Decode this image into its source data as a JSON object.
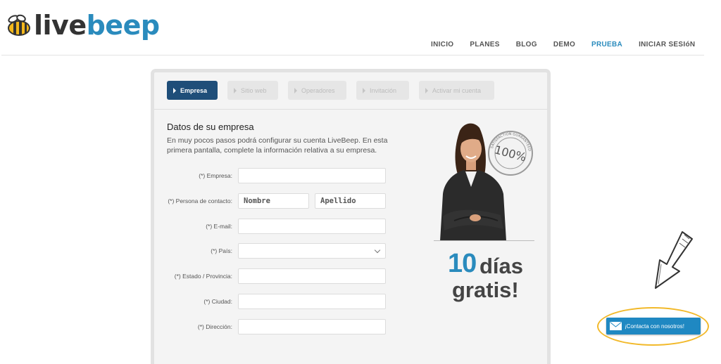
{
  "brand": {
    "live": "live",
    "beep": "beep"
  },
  "nav": {
    "items": [
      {
        "label": "INICIO",
        "active": false
      },
      {
        "label": "PLANES",
        "active": false
      },
      {
        "label": "BLOG",
        "active": false
      },
      {
        "label": "DEMO",
        "active": false
      },
      {
        "label": "PRUEBA",
        "active": true
      },
      {
        "label": "INICIAR SESIóN",
        "active": false
      }
    ]
  },
  "steps": [
    {
      "label": "Empresa",
      "active": true
    },
    {
      "label": "Sitio web",
      "active": false
    },
    {
      "label": "Operadores",
      "active": false
    },
    {
      "label": "Invitación",
      "active": false
    },
    {
      "label": "Activar mi cuenta",
      "active": false
    }
  ],
  "form": {
    "title": "Datos de su empresa",
    "description": "En muy pocos pasos podrá configurar su cuenta LiveBeep. En esta primera pantalla, complete la información relativa a su empresa.",
    "fields": {
      "empresa": {
        "label": "(*) Empresa:",
        "value": ""
      },
      "contacto": {
        "label": "(*) Persona de contacto:",
        "nombre_placeholder": "Nombre",
        "apellido_placeholder": "Apellido"
      },
      "email": {
        "label": "(*) E-mail:",
        "value": ""
      },
      "pais": {
        "label": "(*) País:",
        "value": ""
      },
      "estado": {
        "label": "(*) Estado / Provincia:",
        "value": ""
      },
      "ciudad": {
        "label": "(*) Ciudad:",
        "value": ""
      },
      "direccion": {
        "label": "(*) Dirección:",
        "value": ""
      }
    }
  },
  "promo": {
    "number": "10",
    "days": "días",
    "free": "gratis!",
    "seal_text": "100%",
    "seal_ring": "SATISFACTION GUARANTEED"
  },
  "contact": {
    "label": "¡Contacta con nosotros!"
  },
  "colors": {
    "accent": "#2a8bbd",
    "step_active": "#1f4e79",
    "contact_button": "#1f88c2",
    "highlight": "#f2b92a"
  }
}
